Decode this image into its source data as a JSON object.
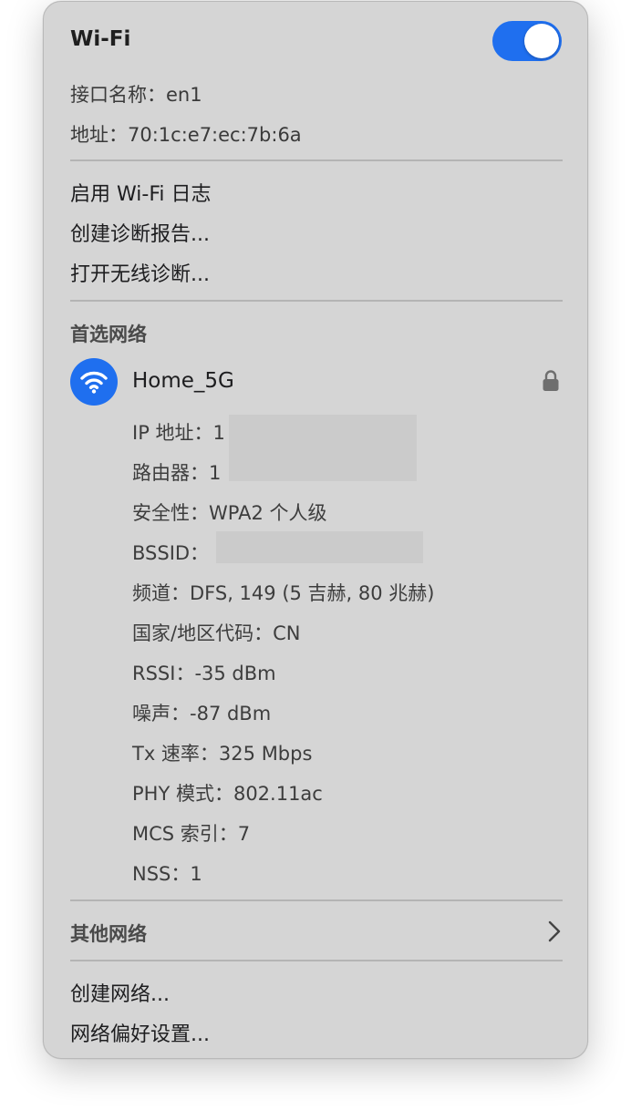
{
  "wifi": {
    "title": "Wi-Fi",
    "toggle_on": true,
    "interface_label": "接口名称：",
    "interface_value": "en1",
    "address_label": "地址：",
    "address_value": "70:1c:e7:ec:7b:6a"
  },
  "actions": {
    "enable_log": "启用 Wi-Fi 日志",
    "create_report": "创建诊断报告...",
    "open_diagnostics": "打开无线诊断..."
  },
  "preferred": {
    "heading": "首选网络",
    "network_name": "Home_5G",
    "icons": {
      "wifi": "wifi-icon",
      "lock": "lock-icon"
    },
    "details": {
      "ip_label": "IP 地址：",
      "ip_value": "1",
      "router_label": "路由器：",
      "router_value": "1",
      "security": "安全性：WPA2 个人级",
      "bssid_label": "BSSID：",
      "channel": "频道：DFS, 149 (5 吉赫, 80 兆赫)",
      "country": "国家/地区代码：CN",
      "rssi": "RSSI：-35 dBm",
      "noise": "噪声：-87 dBm",
      "tx_rate": "Tx 速率：325 Mbps",
      "phy_mode": "PHY 模式：802.11ac",
      "mcs_index": "MCS 索引：7",
      "nss": "NSS：1"
    }
  },
  "other": {
    "label": "其他网络",
    "icon": "chevron-right-icon"
  },
  "bottom": {
    "create_network": "创建网络...",
    "network_prefs": "网络偏好设置..."
  },
  "colors": {
    "accent": "#1f6fef",
    "menu_bg": "#d5d5d5"
  }
}
